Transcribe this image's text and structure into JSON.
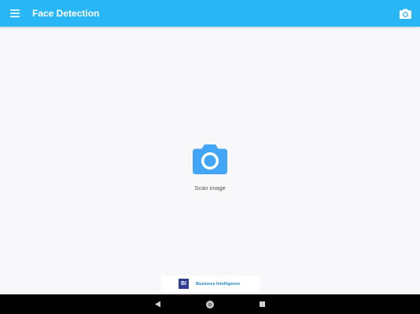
{
  "app_bar": {
    "title": "Face Detection",
    "menu_icon": "hamburger-menu-icon",
    "action_icon": "camera-icon",
    "background_color": "#29b6f6"
  },
  "main": {
    "scan_button": {
      "icon": "camera-icon",
      "label": "Scan image",
      "icon_color": "#42a5f5"
    }
  },
  "ad_banner": {
    "logo_text": "BI",
    "text": "Business Intelligence"
  },
  "system_nav": {
    "back_icon": "back-triangle-icon",
    "home_icon": "home-circle-icon",
    "recents_icon": "recents-square-icon"
  }
}
